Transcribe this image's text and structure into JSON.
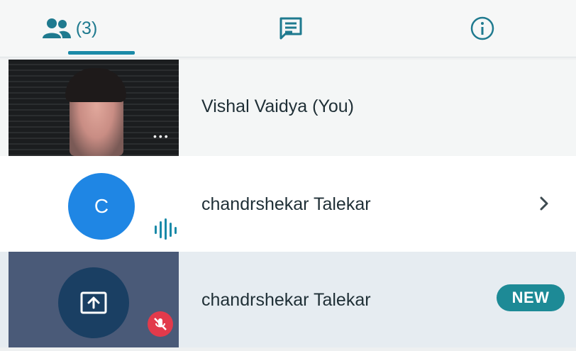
{
  "tabs": {
    "people": {
      "count": "(3)",
      "icon": "people-icon"
    },
    "chat": {
      "icon": "chat-icon"
    },
    "info": {
      "icon": "info-icon"
    }
  },
  "participants": [
    {
      "name": "Vishal Vaidya (You)",
      "type": "video",
      "more_icon": "more-dots-icon"
    },
    {
      "name": "chandrshekar Talekar",
      "avatar_letter": "C",
      "avatar_color": "#1f86e4",
      "status_icon": "speaking-icon",
      "action_icon": "chevron-right-icon"
    },
    {
      "name": "chandrshekar Talekar",
      "type": "screen-share",
      "status_icon": "mic-off-icon",
      "badge": "NEW"
    }
  ],
  "colors": {
    "accent": "#1a8aa8",
    "badge": "#1d8a96",
    "muted": "#e23a4b"
  }
}
